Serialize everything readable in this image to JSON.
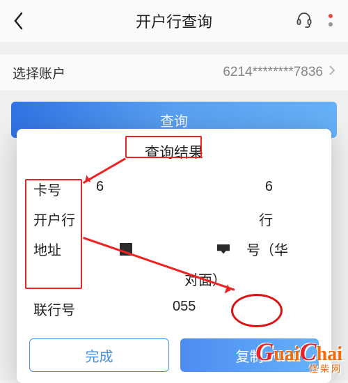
{
  "header": {
    "title": "开户行查询"
  },
  "account": {
    "label": "选择账户",
    "value": "6214********7836"
  },
  "query_button": "查询",
  "dialog": {
    "title": "查询结果",
    "labels": {
      "card": "卡号",
      "bank": "开户行",
      "addr": "地址",
      "code": "联行号"
    },
    "values": {
      "card_prefix": "6",
      "card_suffix": "6",
      "bank_suffix": "行",
      "addr_suffix": "号（华",
      "addr_line2": "对面）",
      "code_suffix": "055"
    },
    "buttons": {
      "done": "完成",
      "copy": "复制"
    }
  },
  "watermark": {
    "brand": "GuaiChai",
    "sub": "怪柴网"
  }
}
